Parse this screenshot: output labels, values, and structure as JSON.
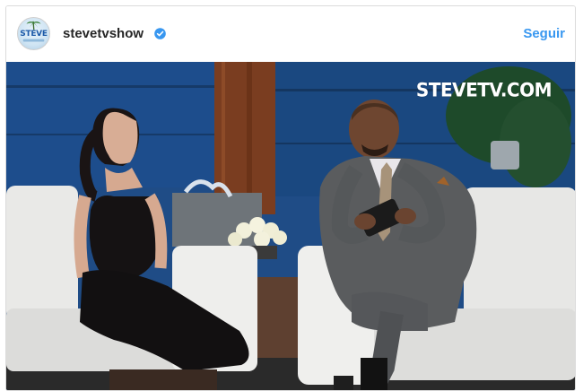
{
  "post": {
    "account": {
      "avatar_text": "STEVE",
      "username": "stevetvshow",
      "verified": true
    },
    "follow_label": "Seguir",
    "media": {
      "watermark": "STEVETV.COM"
    }
  },
  "colors": {
    "follow_blue": "#3897f0",
    "verified_blue": "#3897f0",
    "username": "#262626",
    "border": "#dbdbdb"
  },
  "icons": {
    "verified": "verified-badge-icon"
  }
}
